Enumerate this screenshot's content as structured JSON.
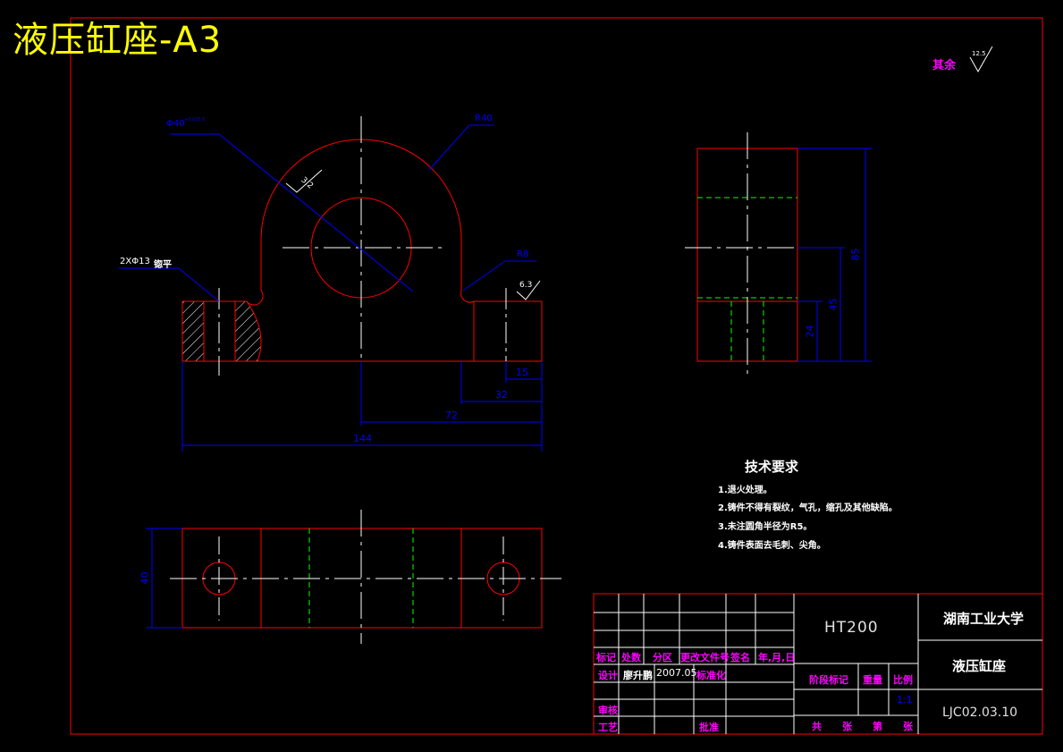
{
  "sheet_title": "液压缸座-A3",
  "roughness_note": {
    "label": "其余",
    "value": "12.5"
  },
  "dimensions": {
    "bore_dia": "Φ40",
    "bore_tol": "+0.025 0",
    "outer_radius": "R40",
    "hole_note": "2XΦ13",
    "hole_note_suffix": "锪平",
    "fillet_radius": "R8",
    "roughness_bore": "3.2",
    "roughness_base": "6.3",
    "d15": "15",
    "d32": "32",
    "d72": "72",
    "d144": "144",
    "d40": "40",
    "d85": "85",
    "d45": "45",
    "d24": "24"
  },
  "tech_requirements": {
    "title": "技术要求",
    "items": [
      "1.退火处理。",
      "2.铸件不得有裂纹，气孔，缩孔及其他缺陷。",
      "3.未注圆角半径为R5。",
      "4.铸件表面去毛刺、尖角。"
    ]
  },
  "title_block": {
    "material": "HT200",
    "school": "湖南工业大学",
    "part_name": "液压缸座",
    "drawing_no": "LJC02.03.10",
    "scale": "1:1",
    "headers": [
      "标记",
      "处数",
      "分区",
      "更改文件号",
      "签名",
      "年,月,日"
    ],
    "design_label": "设计",
    "designer": "廖升鹏",
    "design_date": "2007.05",
    "standardize_label": "标准化",
    "stage_label": "阶段标记",
    "weight_label": "重量",
    "scale_label": "比例",
    "review_label": "审核",
    "process_label": "工艺",
    "approve_label": "批准",
    "sheets_label": "共　张　第　张"
  },
  "colors": {
    "outline": "#ff0000",
    "center_line": "#ffffff",
    "dimension": "#0000ff",
    "hidden_line": "#00ff00",
    "title": "#ffff00",
    "label": "#ff00ff"
  }
}
